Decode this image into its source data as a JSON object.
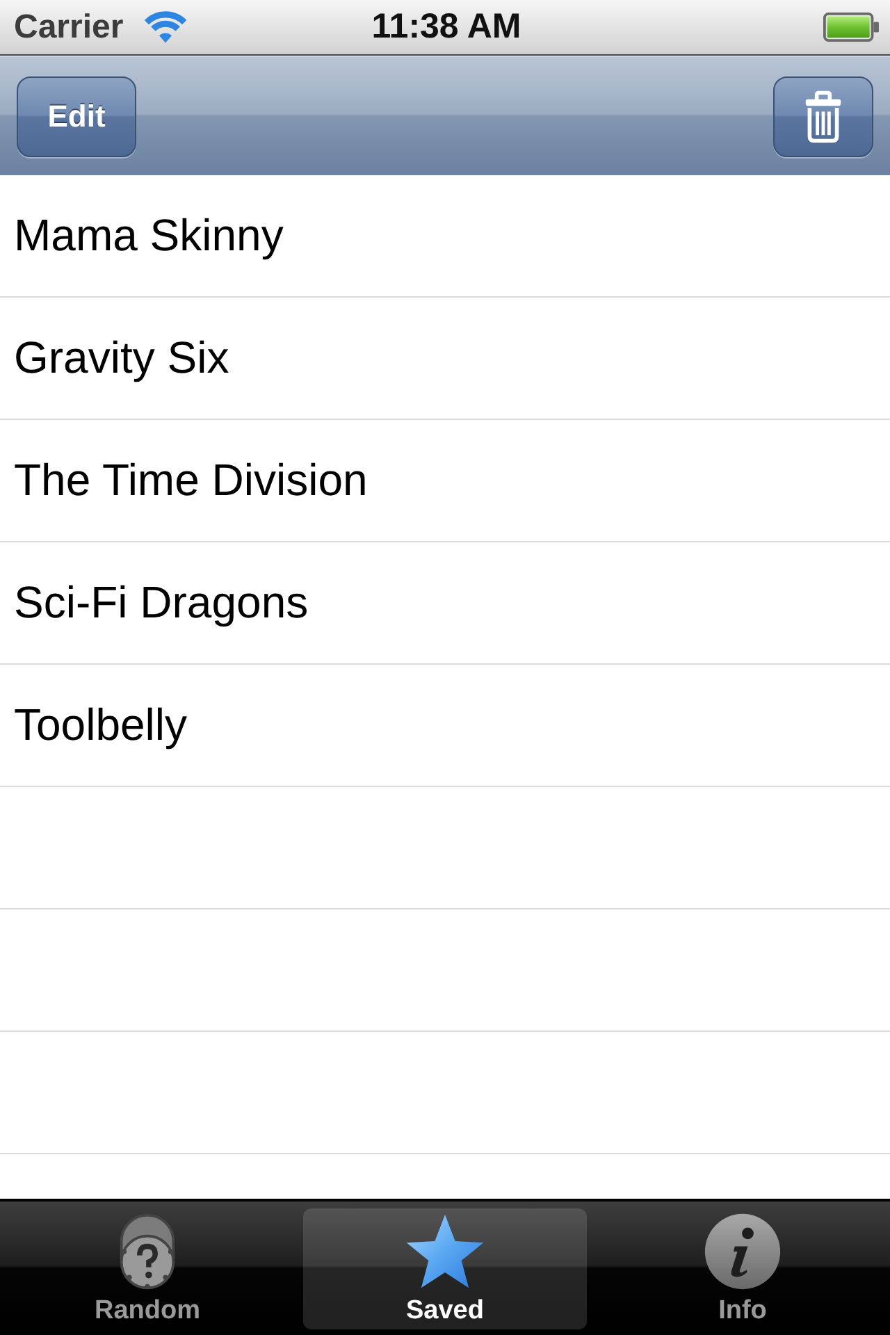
{
  "status_bar": {
    "carrier": "Carrier",
    "time": "11:38 AM"
  },
  "nav_bar": {
    "edit_button": {
      "label": "Edit"
    }
  },
  "list": {
    "items": [
      {
        "title": "Mama Skinny"
      },
      {
        "title": "Gravity Six"
      },
      {
        "title": "The Time Division"
      },
      {
        "title": "Sci-Fi Dragons"
      },
      {
        "title": "Toolbelly"
      }
    ]
  },
  "tabs": [
    {
      "kind": "random",
      "label": "Random",
      "selected": false
    },
    {
      "kind": "saved",
      "label": "Saved",
      "selected": true
    },
    {
      "kind": "info",
      "label": "Info",
      "selected": false
    }
  ]
}
